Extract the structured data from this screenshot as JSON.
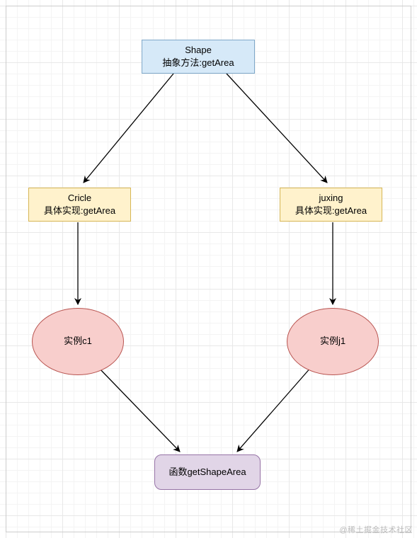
{
  "nodes": {
    "shape": {
      "line1": "Shape",
      "line2": "抽象方法:getArea"
    },
    "circle": {
      "line1": "Cricle",
      "line2": "具体实现:getArea"
    },
    "juxing": {
      "line1": "juxing",
      "line2": "具体实现:getArea"
    },
    "c1": {
      "label": "实例c1"
    },
    "j1": {
      "label": "实例j1"
    },
    "func": {
      "label": "函数getShapeArea"
    }
  },
  "watermark": "@稀土掘金技术社区"
}
